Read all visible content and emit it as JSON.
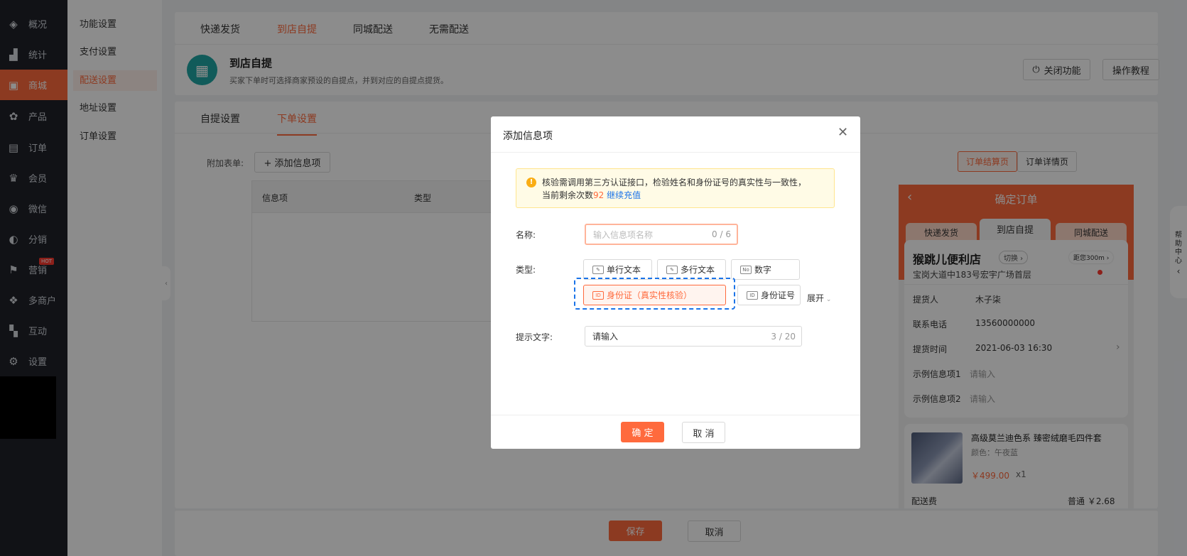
{
  "nav": {
    "items": [
      {
        "label": "概况",
        "icon": "layers-icon",
        "glyph": "◈"
      },
      {
        "label": "统计",
        "icon": "chart-icon",
        "glyph": "▟"
      },
      {
        "label": "商城",
        "icon": "shop-icon",
        "glyph": "▣"
      },
      {
        "label": "产品",
        "icon": "apps-icon",
        "glyph": "✿"
      },
      {
        "label": "订单",
        "icon": "order-icon",
        "glyph": "▤"
      },
      {
        "label": "会员",
        "icon": "crown-icon",
        "glyph": "♛"
      },
      {
        "label": "微信",
        "icon": "wechat-icon",
        "glyph": "◉"
      },
      {
        "label": "分销",
        "icon": "user-icon",
        "glyph": "◐"
      },
      {
        "label": "营销",
        "icon": "flag-icon",
        "glyph": "⚑"
      },
      {
        "label": "多商户",
        "icon": "merchant-icon",
        "glyph": "❖"
      },
      {
        "label": "互动",
        "icon": "interact-icon",
        "glyph": "▚"
      },
      {
        "label": "设置",
        "icon": "gear-icon",
        "glyph": "⚙"
      }
    ],
    "hot_badge": "HOT"
  },
  "submenu": {
    "items": [
      "功能设置",
      "支付设置",
      "配送设置",
      "地址设置",
      "订单设置"
    ]
  },
  "top_tabs": [
    "快递发货",
    "到店自提",
    "同城配送",
    "无需配送"
  ],
  "header": {
    "title": "到店自提",
    "desc": "买家下单时可选择商家预设的自提点，并到对应的自提点提货。",
    "close_btn": "关闭功能",
    "tutorial_btn": "操作教程"
  },
  "main": {
    "tabs": [
      "自提设置",
      "下单设置"
    ],
    "form_label": "附加表单:",
    "add_btn": "+ 添加信息项",
    "table_headers": [
      "信息项",
      "类型"
    ],
    "seg_btns": [
      "订单结算页",
      "订单详情页"
    ]
  },
  "phone": {
    "title": "确定订单",
    "tabs": [
      "快递发货",
      "到店自提",
      "同城配送"
    ],
    "store_name": "猴跳儿便利店",
    "switch": "切换 ›",
    "address": "宝岗大道中183号宏宇广场首层",
    "distance": "距您300m ›",
    "rows": [
      {
        "label": "提货人",
        "value": "木子柒"
      },
      {
        "label": "联系电话",
        "value": "13560000000"
      },
      {
        "label": "提货时间",
        "value": "2021-06-03 16:30"
      },
      {
        "label": "示例信息项1",
        "value": "请输入"
      },
      {
        "label": "示例信息项2",
        "value": "请输入"
      }
    ],
    "product": {
      "name": "高级莫兰迪色系  臻密绒磨毛四件套",
      "attr": "颜色：午夜蓝",
      "price": "￥499.00",
      "qty": "x1"
    },
    "fee_label": "配送费",
    "fee_value": "普通 ￥2.68"
  },
  "footer": {
    "save": "保存",
    "cancel": "取消"
  },
  "help": [
    "帮",
    "助",
    "中",
    "心"
  ],
  "modal": {
    "title": "添加信息项",
    "notice_line1": "核验需调用第三方认证接口，检验姓名和身份证号的真实性与一致性，",
    "notice_line2_prefix": "当前剩余次数",
    "notice_remaining": "92",
    "notice_link": "继续充值",
    "name_label": "名称:",
    "name_placeholder": "输入信息项名称",
    "name_count": "0 / 6",
    "type_label": "类型:",
    "types": [
      "单行文本",
      "多行文本",
      "数字",
      "身份证（真实性核验）",
      "身份证号"
    ],
    "type_icons": [
      "✎",
      "✎",
      "No",
      "ID",
      "ID"
    ],
    "expand": "展开",
    "hint_label": "提示文字:",
    "hint_value": "请输入",
    "hint_count": "3 / 20",
    "confirm": "确 定",
    "cancel": "取 消"
  },
  "colors": {
    "accent": "#ff6a3d",
    "nav_bg": "#1f2229",
    "highlight": "#1a73e8"
  }
}
